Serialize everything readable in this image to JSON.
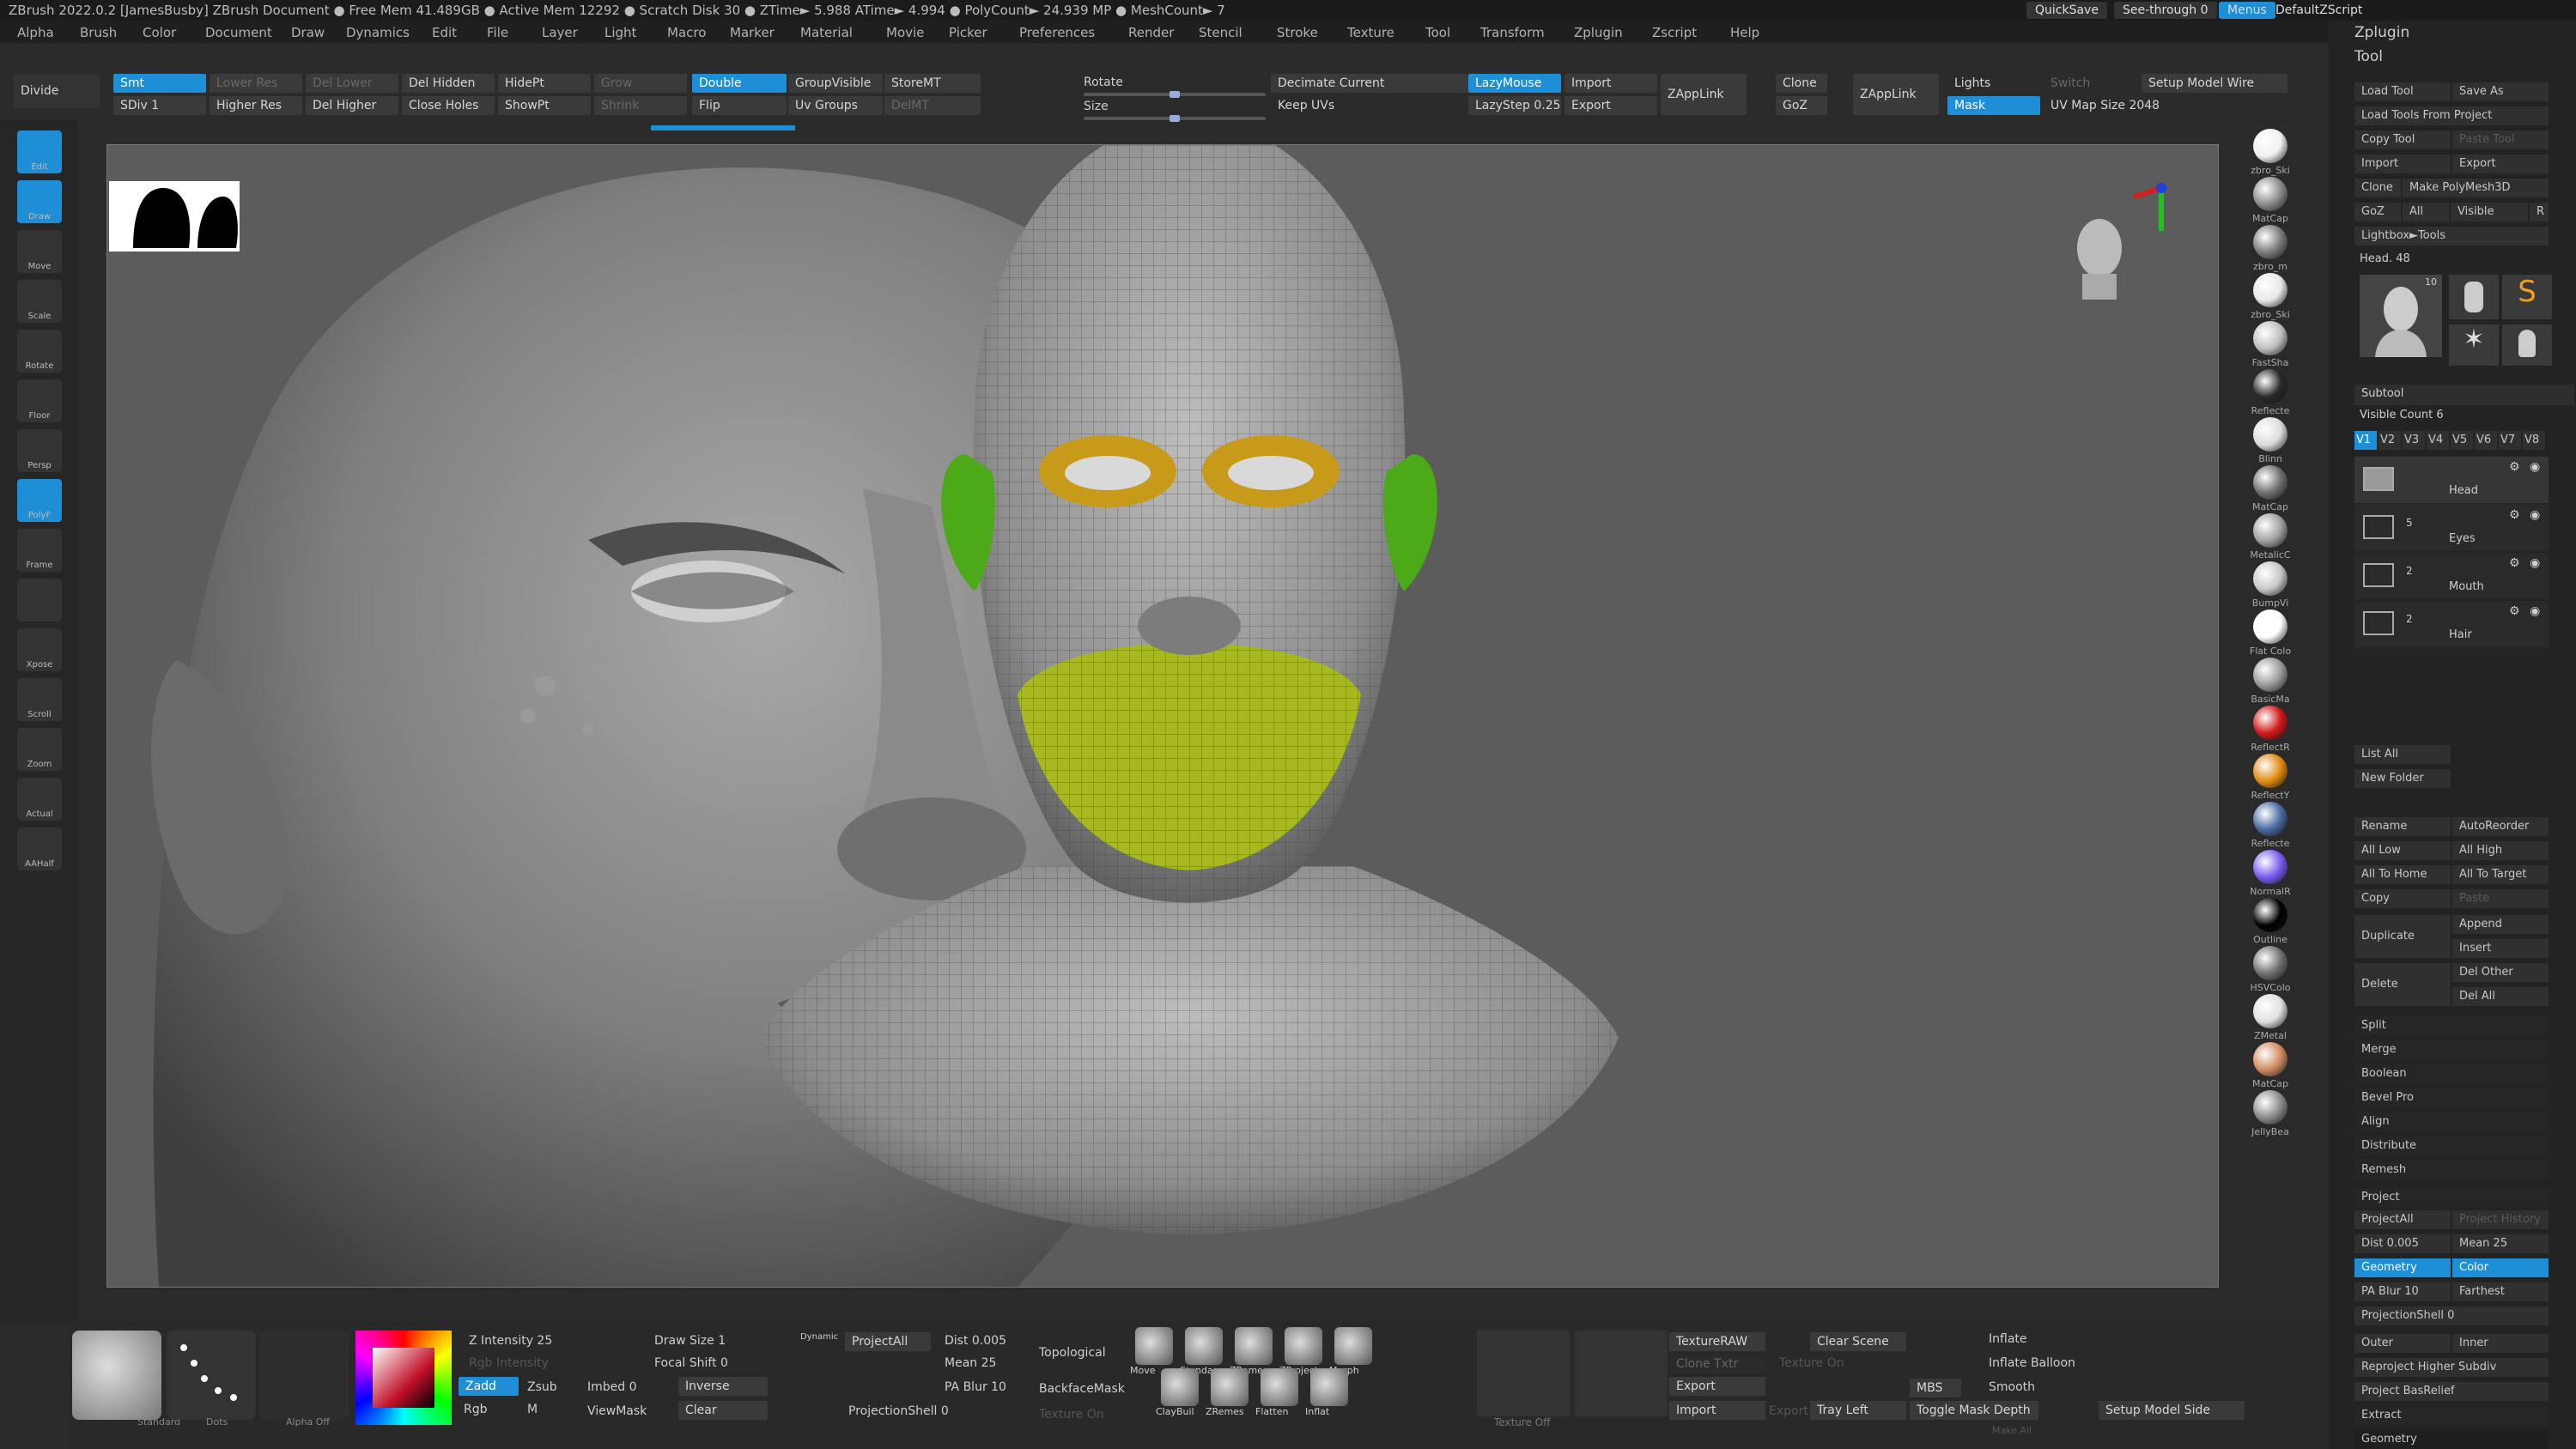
{
  "titlebar": {
    "text": "ZBrush 2022.0.2 [JamesBusby]   ZBrush Document       ● Free Mem 41.489GB ● Active Mem 12292 ● Scratch Disk 30 ● ZTime► 5.988 ATime► 4.994 ● PolyCount► 24.939 MP ● MeshCount► 7",
    "quicksave": "QuickSave",
    "seethrough": "See-through  0",
    "menus": "Menus",
    "defaultzscript": "DefaultZScript"
  },
  "menu": [
    "Alpha",
    "Brush",
    "Color",
    "Document",
    "Draw",
    "Dynamics",
    "Edit",
    "File",
    "Layer",
    "Light",
    "Macro",
    "Marker",
    "Material",
    "Movie",
    "Picker",
    "Preferences",
    "Render",
    "Stencil",
    "Stroke",
    "Texture",
    "Tool",
    "Transform",
    "Zplugin",
    "Zscript",
    "Help"
  ],
  "shelf": {
    "divide": "Divide",
    "smt": "Smt",
    "sdiv": "SDiv 1",
    "lower_res": "Lower Res",
    "higher_res": "Higher Res",
    "del_lower": "Del Lower",
    "del_higher": "Del Higher",
    "del_hidden": "Del Hidden",
    "close_holes": "Close Holes",
    "hidept": "HidePt",
    "showpt": "ShowPt",
    "grow": "Grow",
    "shrink": "Shrink",
    "double": "Double",
    "flip": "Flip",
    "groupvisible": "GroupVisible",
    "uv_groups": "Uv Groups",
    "storemt": "StoreMT",
    "delmt": "DelMT",
    "rotate": "Rotate",
    "size": "Size",
    "decimate": "Decimate Current",
    "keep_uvs": "Keep UVs",
    "lazymouse": "LazyMouse",
    "lazystep": "LazyStep 0.25",
    "import": "Import",
    "export": "Export",
    "zapplink": "ZAppLink",
    "clone": "Clone",
    "goz": "GoZ",
    "zapplink2": "ZAppLink",
    "lights": "Lights",
    "mask": "Mask",
    "switch": "Switch",
    "uv_map": "UV Map Size 2048",
    "setup_model": "Setup Model Wire"
  },
  "left_tools": [
    {
      "label": "Edit",
      "on": true
    },
    {
      "label": "Draw",
      "on": true
    },
    {
      "label": "Move",
      "on": false
    },
    {
      "label": "Scale",
      "on": false
    },
    {
      "label": "Rotate",
      "on": false
    },
    {
      "label": "Floor",
      "on": false
    },
    {
      "label": "Persp",
      "on": false
    },
    {
      "label": "PolyF",
      "on": true
    },
    {
      "label": "Frame",
      "on": false
    },
    {
      "label": "",
      "on": false
    },
    {
      "label": "Xpose",
      "on": false
    },
    {
      "label": "Scroll",
      "on": false
    },
    {
      "label": "Zoom",
      "on": false
    },
    {
      "label": "Actual",
      "on": false
    },
    {
      "label": "AAHalf",
      "on": false
    }
  ],
  "materials": [
    "zbro_Ski",
    "MatCap",
    "zbro_m",
    "zbro_Ski",
    "FastSha",
    "Reflecte",
    "Blinn",
    "MatCap",
    "MetalicC",
    "BumpVi",
    "Flat Colo",
    "BasicMa",
    "ReflectR",
    "ReflectY",
    "Reflecte",
    "NormalR",
    "Outline",
    "HSVColo",
    "ZMetal",
    "MatCap",
    "JellyBea"
  ],
  "mat_colors": [
    "#f0f0f0",
    "#8a8a8a",
    "#7a7a7a",
    "#e8e8e8",
    "#bfbfbf",
    "#2a2a2a",
    "#dcdcdc",
    "#6f6f6f",
    "#a0a0a0",
    "#c8c8c8",
    "#ffffff",
    "#9a9a9a",
    "#d01818",
    "#e08a10",
    "#4a6aa0",
    "#7a5af0",
    "#000000",
    "#707070",
    "#e0e0e0",
    "#d08a60",
    "#8a8a8a"
  ],
  "panel": {
    "zplugin": "Zplugin",
    "tool": "Tool",
    "load_tool": "Load Tool",
    "save_as": "Save As",
    "load_from_project": "Load Tools From Project",
    "copy_tool": "Copy Tool",
    "paste_tool": "Paste Tool",
    "import": "Import",
    "export": "Export",
    "clone": "Clone",
    "make_polymesh": "Make PolyMesh3D",
    "goz": "GoZ",
    "all": "All",
    "visible": "Visible",
    "r": "R",
    "lightbox": "Lightbox►Tools",
    "head_label": "Head. 48",
    "subtool": "Subtool",
    "visible_count": "Visible Count 6",
    "versions": [
      "V1",
      "V2",
      "V3",
      "V4",
      "V5",
      "V6",
      "V7",
      "V8"
    ],
    "subtools": [
      {
        "name": "Head",
        "count": ""
      },
      {
        "name": "Eyes",
        "count": "5"
      },
      {
        "name": "Mouth",
        "count": "2"
      },
      {
        "name": "Hair",
        "count": "2"
      }
    ],
    "list_all": "List All",
    "new_folder": "New Folder",
    "rename": "Rename",
    "autoreorder": "AutoReorder",
    "all_low": "All Low",
    "all_high": "All High",
    "all_to_home": "All To Home",
    "all_to_target": "All To Target",
    "copy": "Copy",
    "paste": "Paste",
    "duplicate": "Duplicate",
    "append": "Append",
    "insert": "Insert",
    "delete": "Delete",
    "del_other": "Del Other",
    "del_all": "Del All",
    "split": "Split",
    "merge": "Merge",
    "boolean": "Boolean",
    "bevel_pro": "Bevel Pro",
    "align": "Align",
    "distribute": "Distribute",
    "remesh": "Remesh",
    "project": "Project",
    "projectall": "ProjectAll",
    "project_history": "Project History",
    "dist": "Dist 0.005",
    "mean": "Mean 25",
    "geometry": "Geometry",
    "color": "Color",
    "pa_blur": "PA Blur 10",
    "farthest": "Farthest",
    "projectionshell": "ProjectionShell 0",
    "outer": "Outer",
    "inner": "Inner",
    "reproject": "Reproject Higher Subdiv",
    "project_basrelief": "Project BasRelief",
    "extract": "Extract",
    "geometry2": "Geometry",
    "tool_thumbs": [
      "Head",
      "Cylinder",
      "SimpleB",
      "PolyMes",
      "Head"
    ],
    "thumb_count": "10"
  },
  "bottom": {
    "standard": "Standard",
    "dots": "Dots",
    "alpha_off": "Alpha Off",
    "z_intensity": "Z Intensity 25",
    "rgb_intensity": "Rgb Intensity",
    "zadd": "Zadd",
    "zsub": "Zsub",
    "rgb": "Rgb",
    "m": "M",
    "draw_size": "Draw Size 1",
    "dynamic": "Dynamic",
    "focal_shift": "Focal Shift 0",
    "imbed": "Imbed 0",
    "inverse": "Inverse",
    "viewmask": "ViewMask",
    "clear": "Clear",
    "projectall": "ProjectAll",
    "dist": "Dist 0.005",
    "mean": "Mean 25",
    "pa_blur": "PA Blur 10",
    "projectionshell": "ProjectionShell 0",
    "topological": "Topological",
    "backfacemask": "BackfaceMask",
    "texture_on": "Texture On",
    "brushes": [
      "Move",
      "Standar",
      "ZRemes",
      "ZProject",
      "Morph",
      "ClayBuil",
      "ZRemes",
      "Flatten",
      "Inflat"
    ],
    "texture_off": "Texture Off",
    "textureraw": "TextureRAW",
    "clone_txtr": "Clone Txtr",
    "export": "Export",
    "import": "Import",
    "texture_on2": "Texture On",
    "export2": "Export",
    "clear_scene": "Clear Scene",
    "tray_left": "Tray Left",
    "mbs": "MBS",
    "toggle_mask_depth": "Toggle Mask Depth",
    "inflate": "Inflate",
    "inflate_balloon": "Inflate Balloon",
    "smooth": "Smooth",
    "setup_model_side": "Setup Model Side",
    "make_all": "Make All"
  }
}
